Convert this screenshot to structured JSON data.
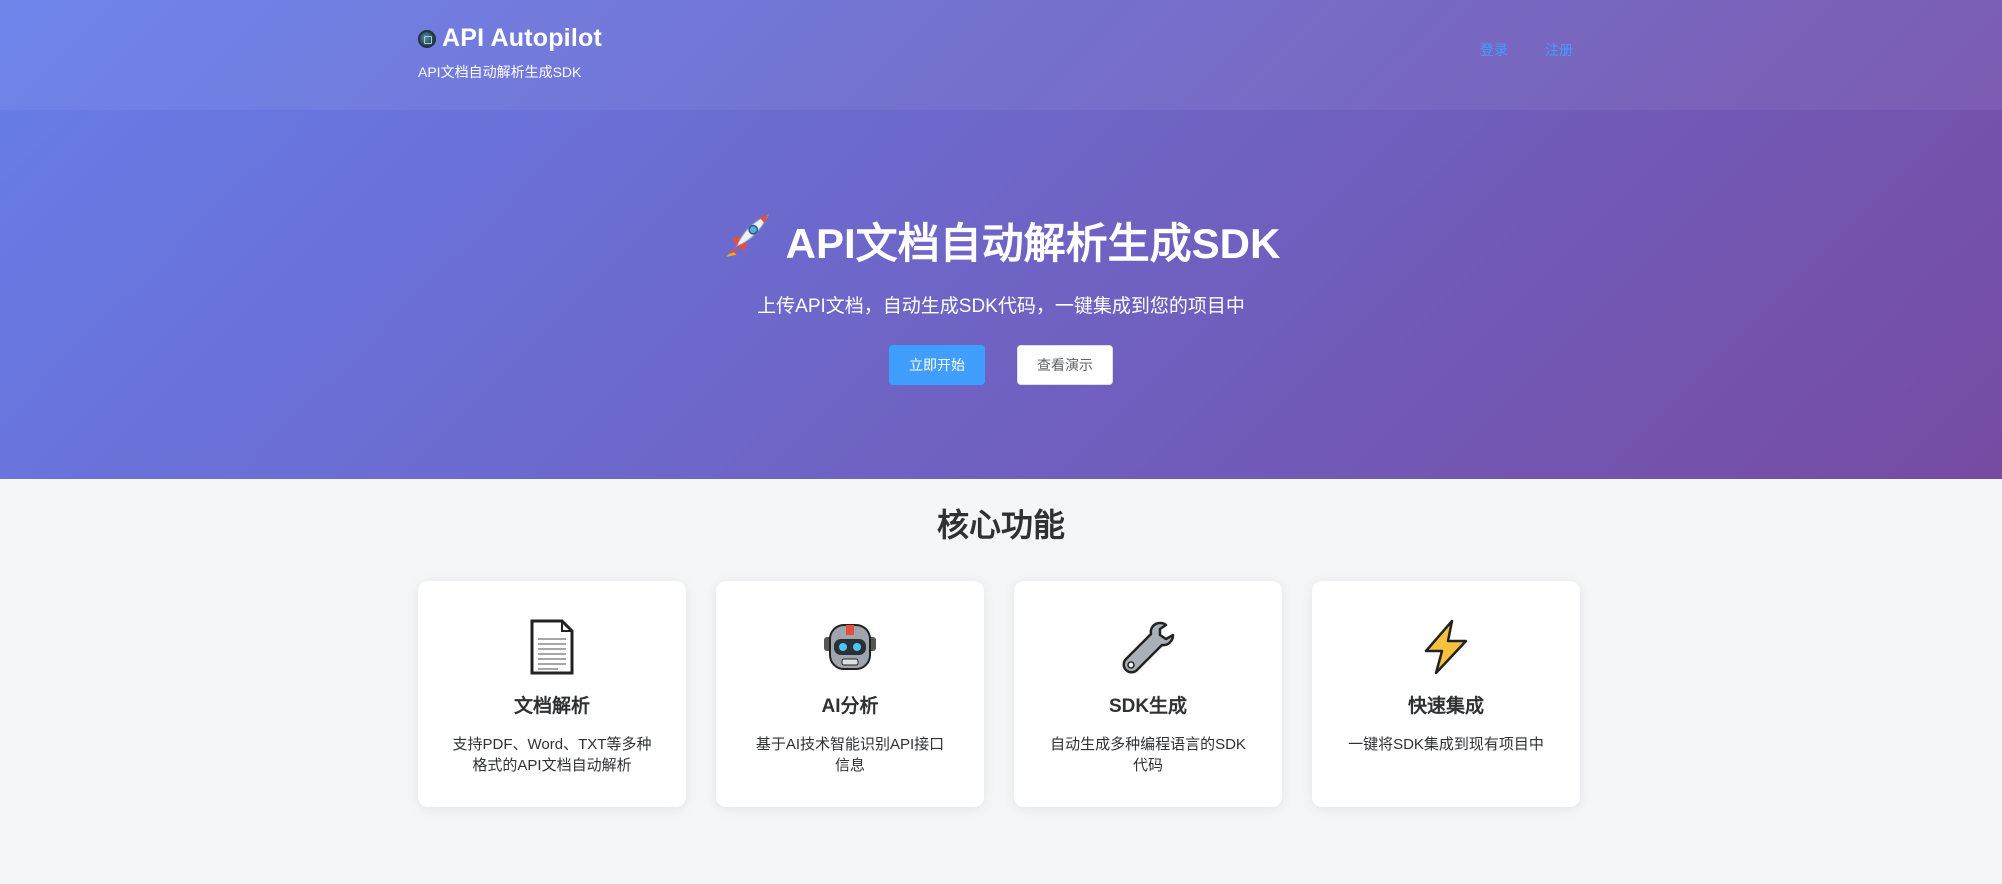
{
  "header": {
    "logo_icon": "robot-logo-icon",
    "title": "API Autopilot",
    "subtitle": "API文档自动解析生成SDK",
    "nav": [
      {
        "label": "登录"
      },
      {
        "label": "注册"
      }
    ]
  },
  "hero": {
    "icon": "rocket-icon",
    "title": "API文档自动解析生成SDK",
    "subtitle": "上传API文档，自动生成SDK代码，一键集成到您的项目中",
    "primary_button": "立即开始",
    "secondary_button": "查看演示"
  },
  "features": {
    "title": "核心功能",
    "cards": [
      {
        "icon": "document-icon",
        "title": "文档解析",
        "desc": "支持PDF、Word、TXT等多种格式的API文档自动解析"
      },
      {
        "icon": "robot-icon",
        "title": "AI分析",
        "desc": "基于AI技术智能识别API接口信息"
      },
      {
        "icon": "wrench-icon",
        "title": "SDK生成",
        "desc": "自动生成多种编程语言的SDK代码"
      },
      {
        "icon": "lightning-icon",
        "title": "快速集成",
        "desc": "一键将SDK集成到现有项目中"
      }
    ]
  },
  "colors": {
    "gradient_start": "#667eea",
    "gradient_end": "#764ba2",
    "primary": "#409eff",
    "background": "#f5f6f8"
  }
}
